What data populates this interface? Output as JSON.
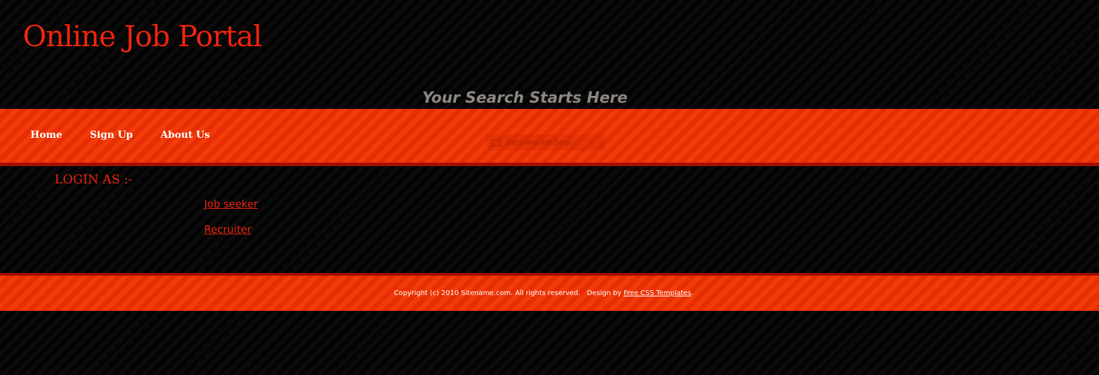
{
  "header": {
    "title": "Online Job Portal",
    "tagline": "Your Search Starts Here"
  },
  "menu": {
    "items": [
      {
        "label": "Home"
      },
      {
        "label": "Sign Up"
      },
      {
        "label": "About Us"
      }
    ]
  },
  "overlay": {
    "label": "Rectangular Snip"
  },
  "content": {
    "heading": "LOGIN AS :-",
    "links": [
      {
        "label": "Job seeker"
      },
      {
        "label": "Recruiter"
      }
    ]
  },
  "footer": {
    "copyright": "Copyright (c) 2010 Sitename.com. All rights reserved.",
    "design_prefix": "Design by",
    "design_link": "Free CSS Templates",
    "suffix": "."
  },
  "colors": {
    "accent": "#f0240e",
    "menu_bar": "#ef3a06",
    "dark_border": "#a50d00",
    "background": "#050505",
    "tagline": "#8d8781"
  }
}
